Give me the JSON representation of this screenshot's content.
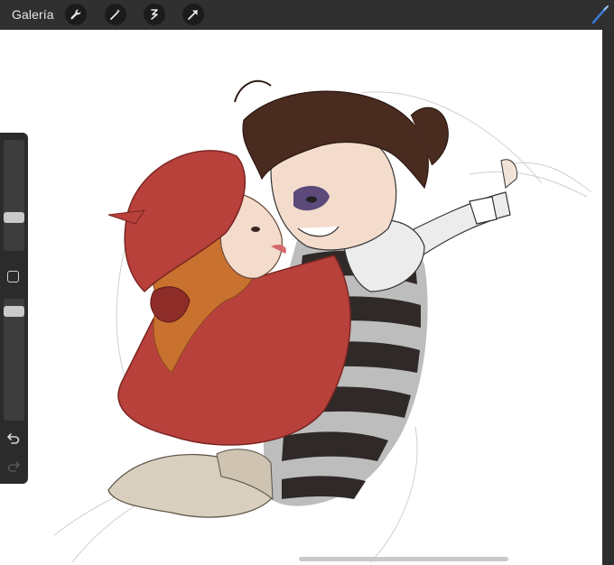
{
  "topbar": {
    "gallery_label": "Galería",
    "tools": [
      {
        "icon": "wrench-icon"
      },
      {
        "icon": "magic-wand-icon"
      },
      {
        "icon": "selection-icon"
      },
      {
        "icon": "transform-arrow-icon"
      }
    ],
    "brush_icon": "brush-icon",
    "brush_color": "#3a7bd5"
  },
  "sidebar": {
    "brush_size_level": 0.3,
    "opacity_level": 0.05,
    "modify_icon": "square-icon",
    "undo_icon": "undo-icon",
    "redo_icon": "redo-icon"
  },
  "canvas": {
    "artwork": "sketch-illustration"
  },
  "colors": {
    "chrome": "#303030",
    "canvas": "#ffffff",
    "cape_red": "#b8413c",
    "hair_orange": "#c9712f",
    "hair_brown": "#4a2b20",
    "stripe_dark": "#2f2a28",
    "stripe_light": "#c7c7c7"
  }
}
